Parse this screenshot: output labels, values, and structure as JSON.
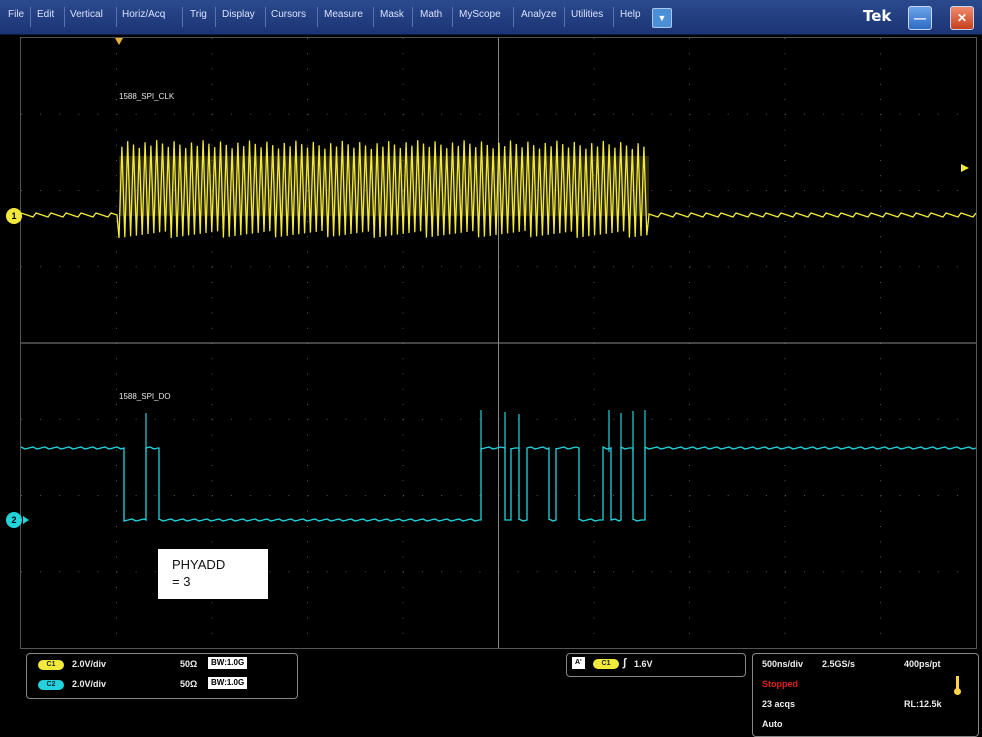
{
  "menu": {
    "items": [
      "File",
      "Edit",
      "Vertical",
      "Horiz/Acq",
      "Trig",
      "Display",
      "Cursors",
      "Measure",
      "Mask",
      "Math",
      "MyScope",
      "Analyze",
      "Utilities",
      "Help"
    ],
    "brand": "Tek",
    "dropdown_icon": "chevron-down-icon",
    "minimize_icon": "minimize-icon",
    "close_icon": "close-icon"
  },
  "colors": {
    "ch1": "#f2ea3b",
    "ch2": "#22d3dc",
    "menu_bg": "#1f3a80",
    "stopped": "#e02020"
  },
  "traces": {
    "ch1_label": "1588_SPI_CLK",
    "ch2_label": "1588_SPI_DO",
    "ch1_marker": "1",
    "ch2_marker": "2"
  },
  "annotation": {
    "line1": "PHYADD",
    "line2": "= 3"
  },
  "status": {
    "ch1": {
      "badge": "C1",
      "scale": "2.0V/div",
      "impedance": "50Ω",
      "bw_prefix": "B",
      "bw": "W:1.0G"
    },
    "ch2": {
      "badge": "C2",
      "scale": "2.0V/div",
      "impedance": "50Ω",
      "bw_prefix": "B",
      "bw": "W:1.0G"
    },
    "trigger": {
      "mode_badge": "A'",
      "source_badge": "C1",
      "level": "1.6V"
    },
    "timebase": {
      "scale": "500ns/div",
      "sample_rate": "2.5GS/s",
      "resolution": "400ps/pt",
      "state": "Stopped",
      "acquisitions": "23 acqs",
      "record_length": "RL:12.5k",
      "trigger_mode": "Auto"
    }
  }
}
